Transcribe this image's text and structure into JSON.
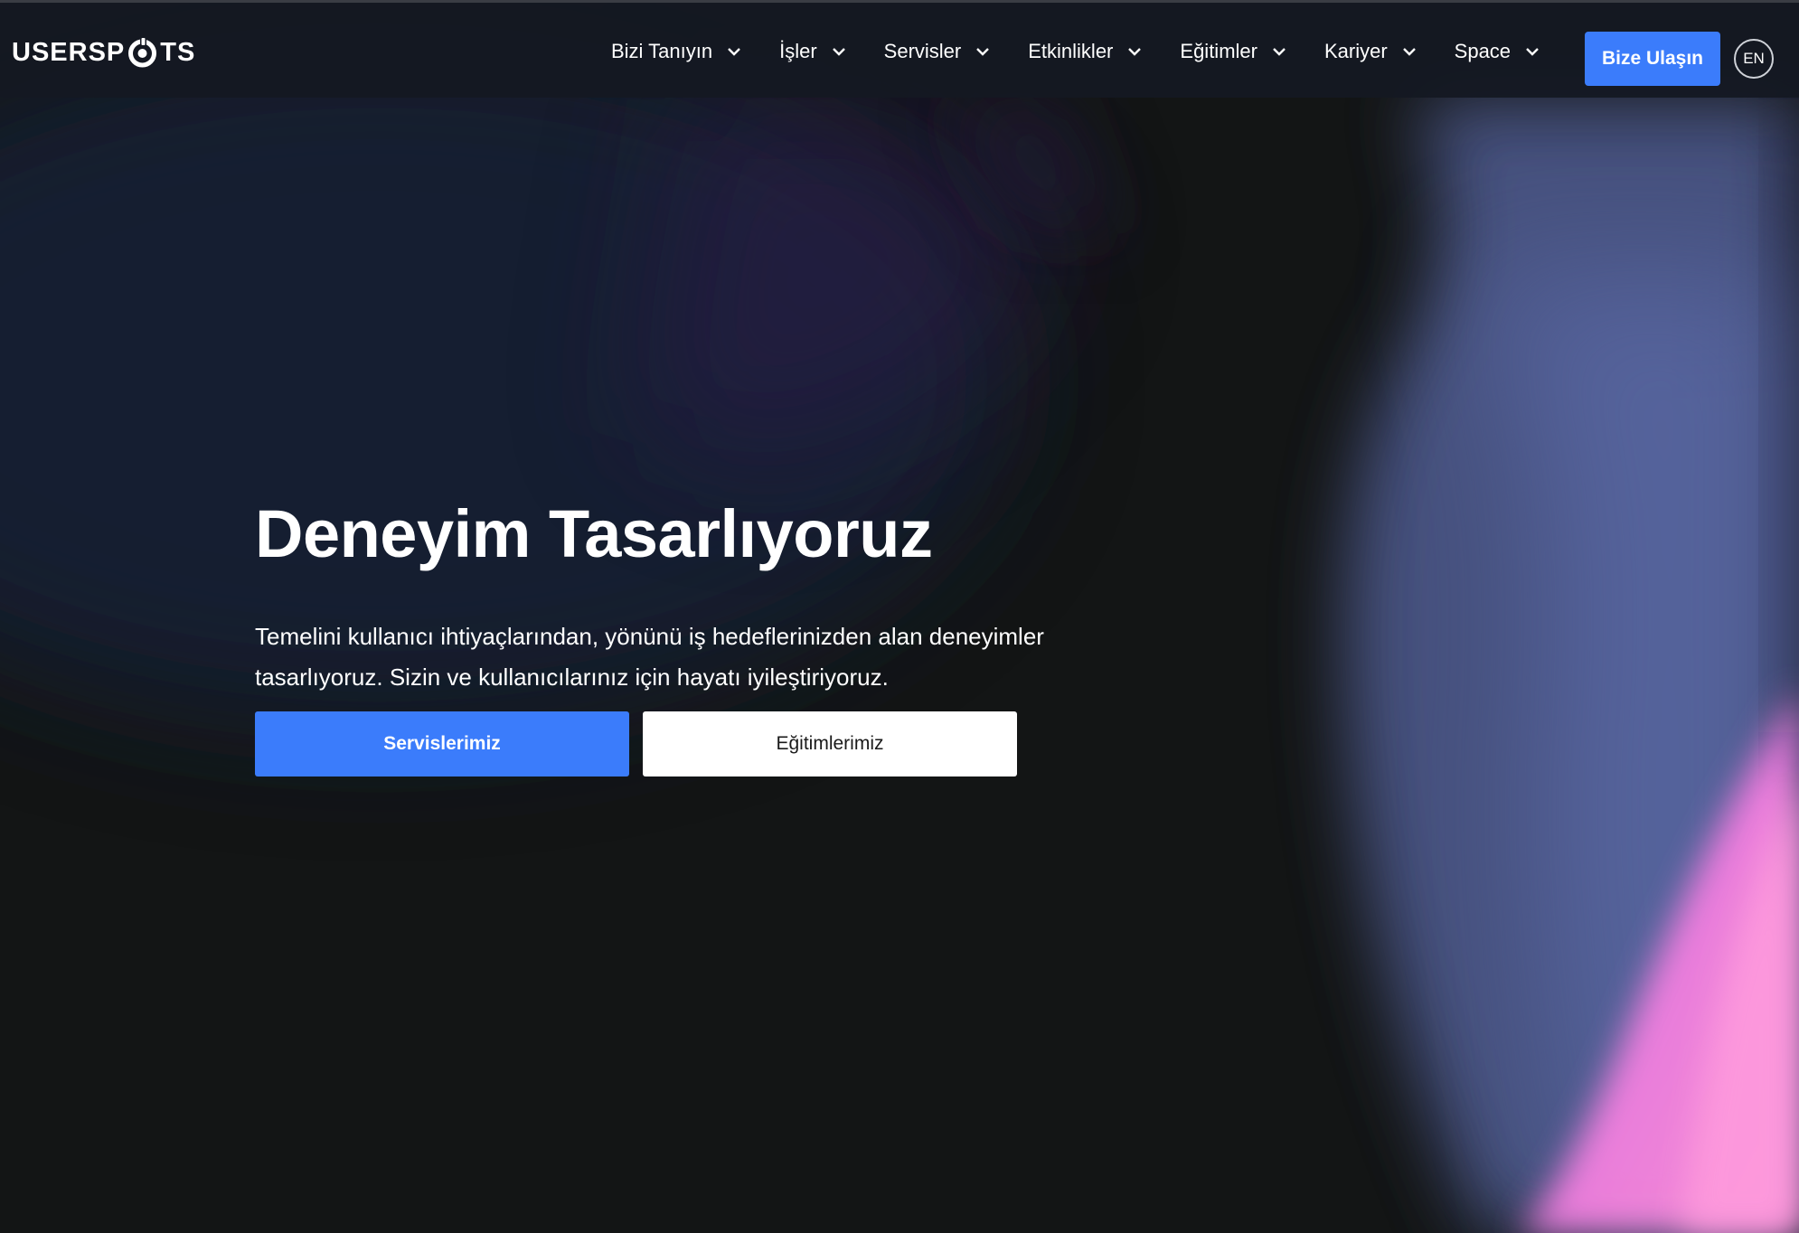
{
  "brand": {
    "logo_text_before": "USERSP",
    "logo_text_after": "TS",
    "logo_icon": "power-ring-icon"
  },
  "nav": {
    "items": [
      {
        "label": "Bizi Tanıyın",
        "icon": "chevron-down-icon"
      },
      {
        "label": "İşler",
        "icon": "chevron-down-icon"
      },
      {
        "label": "Servisler",
        "icon": "chevron-down-icon"
      },
      {
        "label": "Etkinlikler",
        "icon": "chevron-down-icon"
      },
      {
        "label": "Eğitimler",
        "icon": "chevron-down-icon"
      },
      {
        "label": "Kariyer",
        "icon": "chevron-down-icon"
      },
      {
        "label": "Space",
        "icon": "chevron-down-icon"
      }
    ],
    "cta_label": "Bize Ulaşın",
    "language_label": "EN"
  },
  "hero": {
    "title": "Deneyim Tasarlıyoruz",
    "description": "Temelini kullanıcı ihtiyaçlarından, yönünü iş hedeflerinizden alan deneyimler tasarlıyoruz. Sizin ve kullanıcılarınız için hayatı iyileştiriyoruz.",
    "primary_button": "Servislerimiz",
    "secondary_button": "Eğitimlerimiz"
  },
  "colors": {
    "accent": "#3b7cfb",
    "header_bg": "#141822",
    "page_bg": "#131515",
    "hero_glow_blue": "#5b6aa8",
    "hero_glow_pink": "#f07de0"
  }
}
